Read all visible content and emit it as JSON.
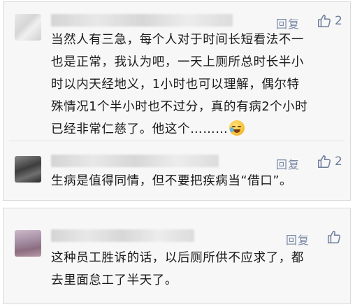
{
  "comments": [
    {
      "nickname": "",
      "reply_label": "回复",
      "like_count": "2",
      "text_lines": [
        "当然人有三急，每个人对于时间长短看法不一",
        "也是正常，我认为吧，一天上厕所总时长半小",
        "时以内天经地义，1小时也可以理解，偶尔特",
        "殊情况1个半小时也不过分，真的有病2个小时",
        "已经非常仁慈了。他这个………"
      ],
      "emoji": "laughing-crying-emoji"
    },
    {
      "nickname": "",
      "reply_label": "回复",
      "like_count": "2",
      "text_lines": [
        "生病是值得同情，但不要把疾病当“借口”。"
      ]
    },
    {
      "nickname": "",
      "reply_label": "回复",
      "like_count": "",
      "text_lines": [
        "这种员工胜诉的话，以后厕所供不应求了，都",
        "去里面怠工了半天了。"
      ]
    }
  ],
  "colors": {
    "link_blue": "#7b8aa6",
    "card_background": "#f7f7f7",
    "card_border": "#d9d9d9",
    "text": "#1a1a1a"
  }
}
